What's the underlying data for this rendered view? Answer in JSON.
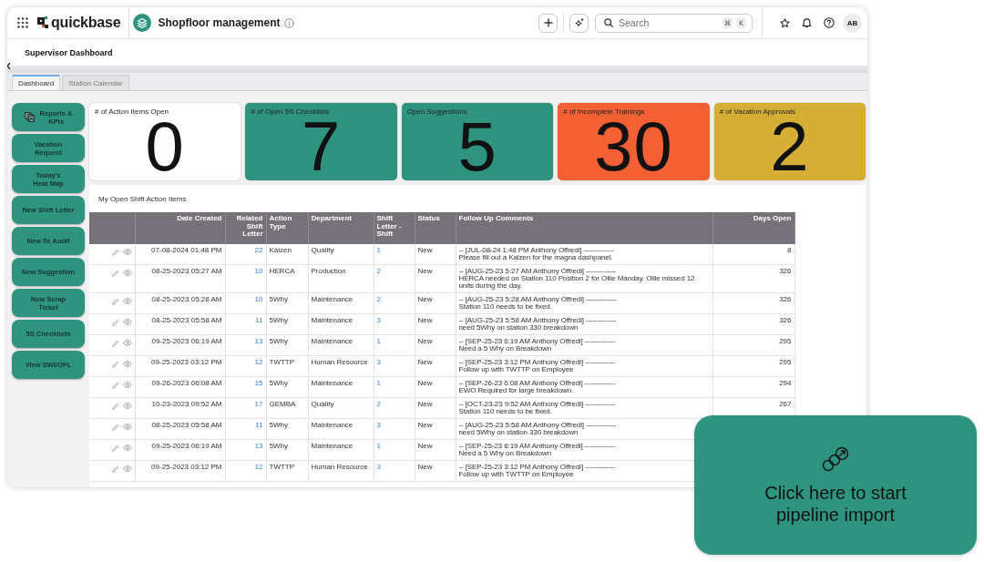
{
  "top_bar": {
    "brand": "quickbase",
    "app_name": "Shopfloor management",
    "search": {
      "placeholder": "Search",
      "shortcut_keys": [
        "⌘",
        "K"
      ]
    },
    "avatar": "AB"
  },
  "page_title": "Supervisor Dashboard",
  "tabs": [
    {
      "label": "Dashboard",
      "selected": true
    },
    {
      "label": "Station Calendar",
      "selected": false
    }
  ],
  "sidebar": {
    "buttons": [
      {
        "label": "Reports &\nKPIs",
        "kind": "icon"
      },
      {
        "label": "Vacation\nRequest",
        "kind": "text"
      },
      {
        "label": "Today's\nHeat Map",
        "kind": "text"
      },
      {
        "label": "New Shift Letter",
        "kind": "text"
      },
      {
        "label": "New 5s Audit",
        "kind": "text"
      },
      {
        "label": "New Suggestion",
        "kind": "text"
      },
      {
        "label": "New Scrap\nTicket",
        "kind": "text"
      },
      {
        "label": "5S Checklists",
        "kind": "text"
      },
      {
        "label": "View SWI/OPL",
        "kind": "text"
      }
    ]
  },
  "tiles": [
    {
      "label": "# of Action Items Open",
      "value": "0",
      "color": "#ffffff"
    },
    {
      "label": "# of Open 5S Checklists",
      "value": "7",
      "color": "#2e9480"
    },
    {
      "label": "Open Suggestions",
      "value": "5",
      "color": "#2e9480"
    },
    {
      "label": "# of Incomplete Trainings",
      "value": "30",
      "color": "#f26034"
    },
    {
      "label": "# of Vacation Approvals",
      "value": "2",
      "color": "#d4ae35"
    }
  ],
  "table": {
    "title": "My Open Shift Action Items",
    "columns": [
      {
        "label": "Date Created",
        "kind": "date"
      },
      {
        "label": "Related Shift Letter",
        "kind": "reference"
      },
      {
        "label": "Action Type",
        "kind": "text"
      },
      {
        "label": "Department",
        "kind": "text"
      },
      {
        "label": "Shift Letter - Shift",
        "kind": "link"
      },
      {
        "label": "Status",
        "kind": "text"
      },
      {
        "label": "Follow Up Comments",
        "kind": "comment"
      },
      {
        "label": "Days Open",
        "kind": "number"
      }
    ],
    "rows": [
      {
        "cells": [
          "07-08-2024 01:48 PM",
          "22",
          "Kaizen",
          "Quality",
          "1",
          "New",
          "-- [JUL-08-24 1:48 PM Anthony Offredi] -------------\nPlease fill out a Kaizen for the magna dashpanel.",
          "8"
        ]
      },
      {
        "cells": [
          "08-25-2023 05:27 AM",
          "10",
          "HERCA",
          "Production",
          "2",
          "New",
          "-- [AUG-25-23 5:27 AM Anthony Offredi] -------------\nHERCA needed on Station 110 Position 2 for Ollie Manday. Ollie missed 12 units during the day.",
          "326"
        ]
      },
      {
        "cells": [
          "08-25-2023 05:28 AM",
          "10",
          "5Why",
          "Maintenance",
          "2",
          "New",
          "-- [AUG-25-23 5:28 AM Anthony Offredi] -------------\nStation 110 needs to be fixed.",
          "326"
        ]
      },
      {
        "cells": [
          "08-25-2023 05:58 AM",
          "11",
          "5Why",
          "Maintenance",
          "3",
          "New",
          "-- [AUG-25-23 5:58 AM Anthony Offredi] -------------\nneed 5Why on station 330 breakdown",
          "326"
        ]
      },
      {
        "cells": [
          "09-25-2023 06:19 AM",
          "13",
          "5Why",
          "Maintenance",
          "1",
          "New",
          "-- [SEP-25-23 6:19 AM Anthony Offredi] -------------\nNeed a 5 Why on Breakdown",
          "295"
        ]
      },
      {
        "cells": [
          "09-25-2023 03:12 PM",
          "12",
          "TWTTP",
          "Human Resource",
          "3",
          "New",
          "-- [SEP-25-23 3:12 PM Anthony Offredi] -------------\nFollow up with TWTTP on Employee",
          "295"
        ]
      },
      {
        "cells": [
          "09-26-2023 06:08 AM",
          "15",
          "5Why",
          "Maintenance",
          "1",
          "New",
          "-- [SEP-26-23 6:08 AM Anthony Offredi] -------------\nEWO Required for large breakdown.",
          "294"
        ]
      },
      {
        "cells": [
          "10-23-2023 09:52 AM",
          "17",
          "GEMBA",
          "Quality",
          "2",
          "New",
          "-- [OCT-23-23 9:52 AM Anthony Offredi] -------------\nStation 110 needs to be fixed.",
          "267"
        ]
      },
      {
        "cells": [
          "08-25-2023 05:58 AM",
          "11",
          "5Why",
          "Maintenance",
          "3",
          "New",
          "-- [AUG-25-23 5:58 AM Anthony Offredi] -------------\nneed 5Why on station 330 breakdown"
        ]
      },
      {
        "cells": [
          "09-25-2023 06:19 AM",
          "13",
          "5Why",
          "Maintenance",
          "1",
          "New",
          "-- [SEP-25-23 6:19 AM Anthony Offredi] -------------\nNeed a 5 Why on Breakdown"
        ]
      },
      {
        "cells": [
          "09-25-2023 03:12 PM",
          "12",
          "TWTTP",
          "Human Resource",
          "3",
          "New",
          "-- [SEP-25-23 3:12 PM Anthony Offredi] -------------\nFollow up with TWTTP on Employee"
        ]
      }
    ]
  },
  "overlay_card": {
    "label": "Click here to start pipeline import"
  }
}
